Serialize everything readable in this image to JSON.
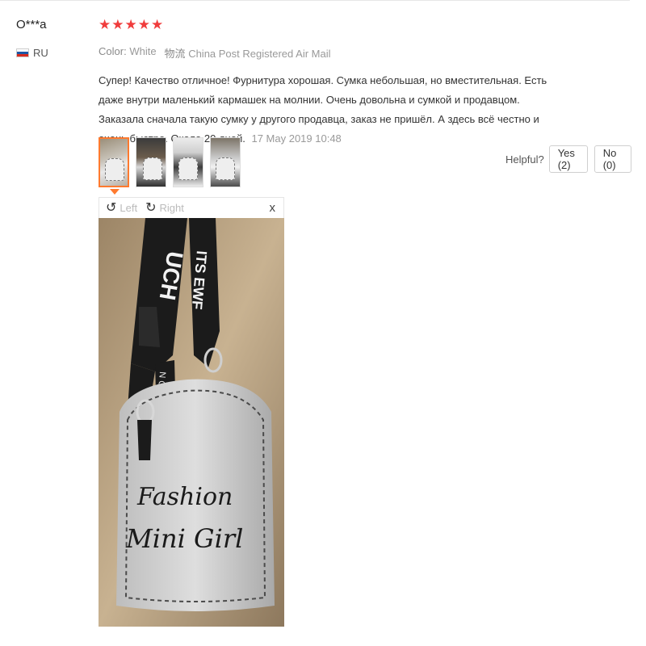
{
  "review": {
    "reviewer": "O***a",
    "country_code": "RU",
    "rating": 5,
    "stars": [
      "★",
      "★",
      "★",
      "★",
      "★"
    ],
    "star_color": "#f03c3c",
    "color_label": "Color:",
    "color_value": "White",
    "shipping_label": "物流",
    "shipping_value": "China Post Registered Air Mail",
    "text": "Супер! Качество отличное! Фурнитура хорошая. Сумка небольшая, но вместительная. Есть даже внутри маленький кармашек на молнии. Очень довольна и сумкой и продавцом. Заказала сначала такую сумку у другого продавца, заказ не пришёл. А здесь всё честно и очень быстро. Около 20 дней.",
    "date": "17 May 2019 10:48"
  },
  "thumbnails": {
    "count": 4,
    "active_index": 0,
    "active_color": "#ff7a2f"
  },
  "viewer": {
    "rotate_left_label": "Left",
    "rotate_right_label": "Right",
    "close_symbol": "x",
    "photo_text_line1": "Fashion",
    "photo_text_line2": "Mini Girl",
    "strap_text_left": "UCH",
    "strap_text_right": "ITS EWF",
    "strap_text_tab": "N C E N I C"
  },
  "helpful": {
    "label": "Helpful?",
    "yes_label": "Yes (2)",
    "no_label": "No (0)"
  },
  "icons": {
    "rotate_left": "rotate-left-icon",
    "rotate_right": "rotate-right-icon",
    "close": "close-icon",
    "flag": "russia-flag-icon",
    "star": "star-icon"
  }
}
